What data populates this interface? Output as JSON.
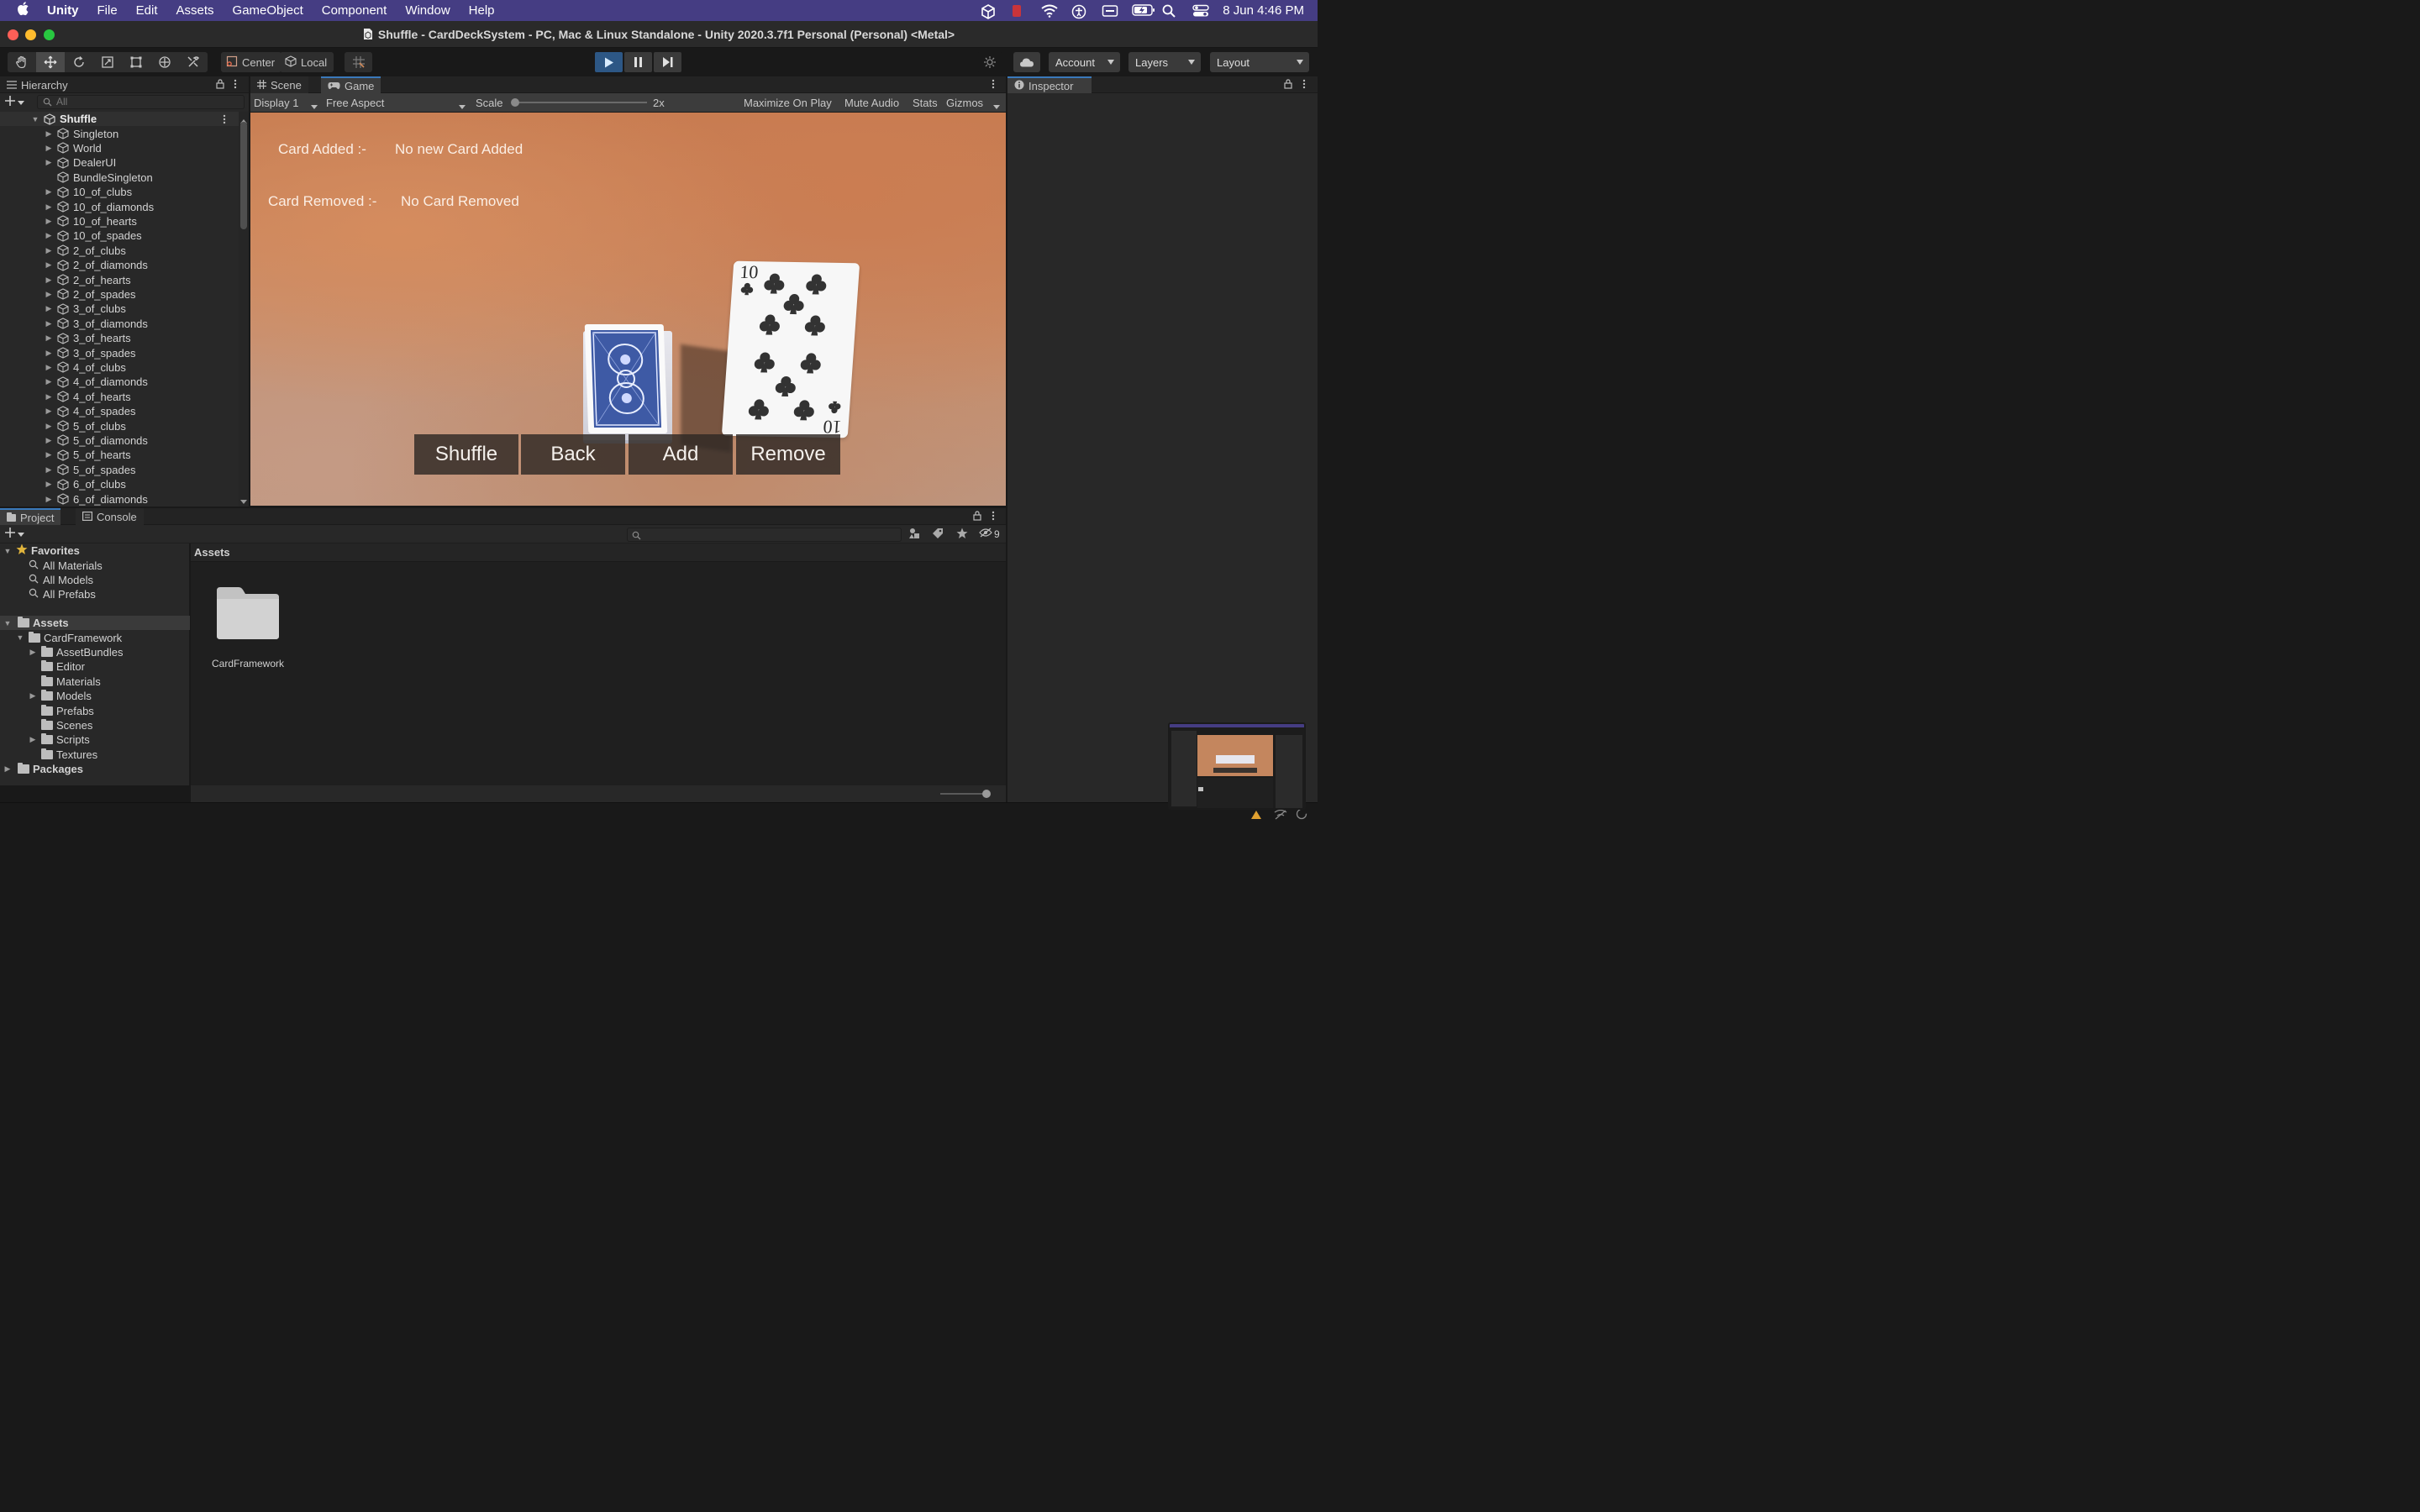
{
  "menubar": {
    "app_name": "Unity",
    "items": [
      "File",
      "Edit",
      "Assets",
      "GameObject",
      "Component",
      "Window",
      "Help"
    ],
    "clock": "8 Jun  4:46 PM"
  },
  "window": {
    "title": "Shuffle - CardDeckSystem - PC, Mac & Linux Standalone - Unity 2020.3.7f1 Personal (Personal) <Metal>"
  },
  "toolbar": {
    "pivot_label": "Center",
    "space_label": "Local",
    "account_label": "Account",
    "layers_label": "Layers",
    "layout_label": "Layout"
  },
  "hierarchy": {
    "tab_label": "Hierarchy",
    "search_placeholder": "All",
    "scene_name": "Shuffle",
    "items": [
      {
        "label": "Singleton",
        "expandable": true
      },
      {
        "label": "World",
        "expandable": true
      },
      {
        "label": "DealerUI",
        "expandable": true
      },
      {
        "label": "BundleSingleton",
        "expandable": false
      },
      {
        "label": "10_of_clubs",
        "expandable": true
      },
      {
        "label": "10_of_diamonds",
        "expandable": true
      },
      {
        "label": "10_of_hearts",
        "expandable": true
      },
      {
        "label": "10_of_spades",
        "expandable": true
      },
      {
        "label": "2_of_clubs",
        "expandable": true
      },
      {
        "label": "2_of_diamonds",
        "expandable": true
      },
      {
        "label": "2_of_hearts",
        "expandable": true
      },
      {
        "label": "2_of_spades",
        "expandable": true
      },
      {
        "label": "3_of_clubs",
        "expandable": true
      },
      {
        "label": "3_of_diamonds",
        "expandable": true
      },
      {
        "label": "3_of_hearts",
        "expandable": true
      },
      {
        "label": "3_of_spades",
        "expandable": true
      },
      {
        "label": "4_of_clubs",
        "expandable": true
      },
      {
        "label": "4_of_diamonds",
        "expandable": true
      },
      {
        "label": "4_of_hearts",
        "expandable": true
      },
      {
        "label": "4_of_spades",
        "expandable": true
      },
      {
        "label": "5_of_clubs",
        "expandable": true
      },
      {
        "label": "5_of_diamonds",
        "expandable": true
      },
      {
        "label": "5_of_hearts",
        "expandable": true
      },
      {
        "label": "5_of_spades",
        "expandable": true
      },
      {
        "label": "6_of_clubs",
        "expandable": true
      },
      {
        "label": "6_of_diamonds",
        "expandable": true
      }
    ]
  },
  "center_tabs": {
    "scene_label": "Scene",
    "game_label": "Game"
  },
  "game_toolbar": {
    "display": "Display 1",
    "aspect": "Free Aspect",
    "scale_label": "Scale",
    "scale_value": "2x",
    "maximize": "Maximize On Play",
    "mute": "Mute Audio",
    "stats": "Stats",
    "gizmos": "Gizmos"
  },
  "game_view": {
    "card_added_label": "Card Added :-",
    "card_added_value": "No new Card Added",
    "card_removed_label": "Card Removed :-",
    "card_removed_value": "No Card Removed",
    "face_card_rank": "10",
    "face_card_rank_flipped": "10",
    "buttons": [
      "Shuffle",
      "Back",
      "Add",
      "Remove"
    ]
  },
  "inspector": {
    "tab_label": "Inspector"
  },
  "project": {
    "tab_label": "Project",
    "console_label": "Console",
    "hidden_count": "9",
    "favorites": {
      "label": "Favorites",
      "items": [
        "All Materials",
        "All Models",
        "All Prefabs"
      ]
    },
    "assets_label": "Assets",
    "tree": [
      {
        "label": "CardFramework",
        "depth": 1,
        "arrow": "▼"
      },
      {
        "label": "AssetBundles",
        "depth": 2,
        "arrow": "▶"
      },
      {
        "label": "Editor",
        "depth": 2,
        "arrow": ""
      },
      {
        "label": "Materials",
        "depth": 2,
        "arrow": ""
      },
      {
        "label": "Models",
        "depth": 2,
        "arrow": "▶"
      },
      {
        "label": "Prefabs",
        "depth": 2,
        "arrow": ""
      },
      {
        "label": "Scenes",
        "depth": 2,
        "arrow": ""
      },
      {
        "label": "Scripts",
        "depth": 2,
        "arrow": "▶"
      },
      {
        "label": "Textures",
        "depth": 2,
        "arrow": ""
      }
    ],
    "packages_label": "Packages",
    "breadcrumb": "Assets",
    "grid_items": [
      {
        "label": "CardFramework",
        "icon": "folder-icon"
      }
    ]
  },
  "colors": {
    "menubar": "#453d83",
    "accent": "#3a79bb",
    "play_active": "#2d5785",
    "panel": "#282828"
  }
}
